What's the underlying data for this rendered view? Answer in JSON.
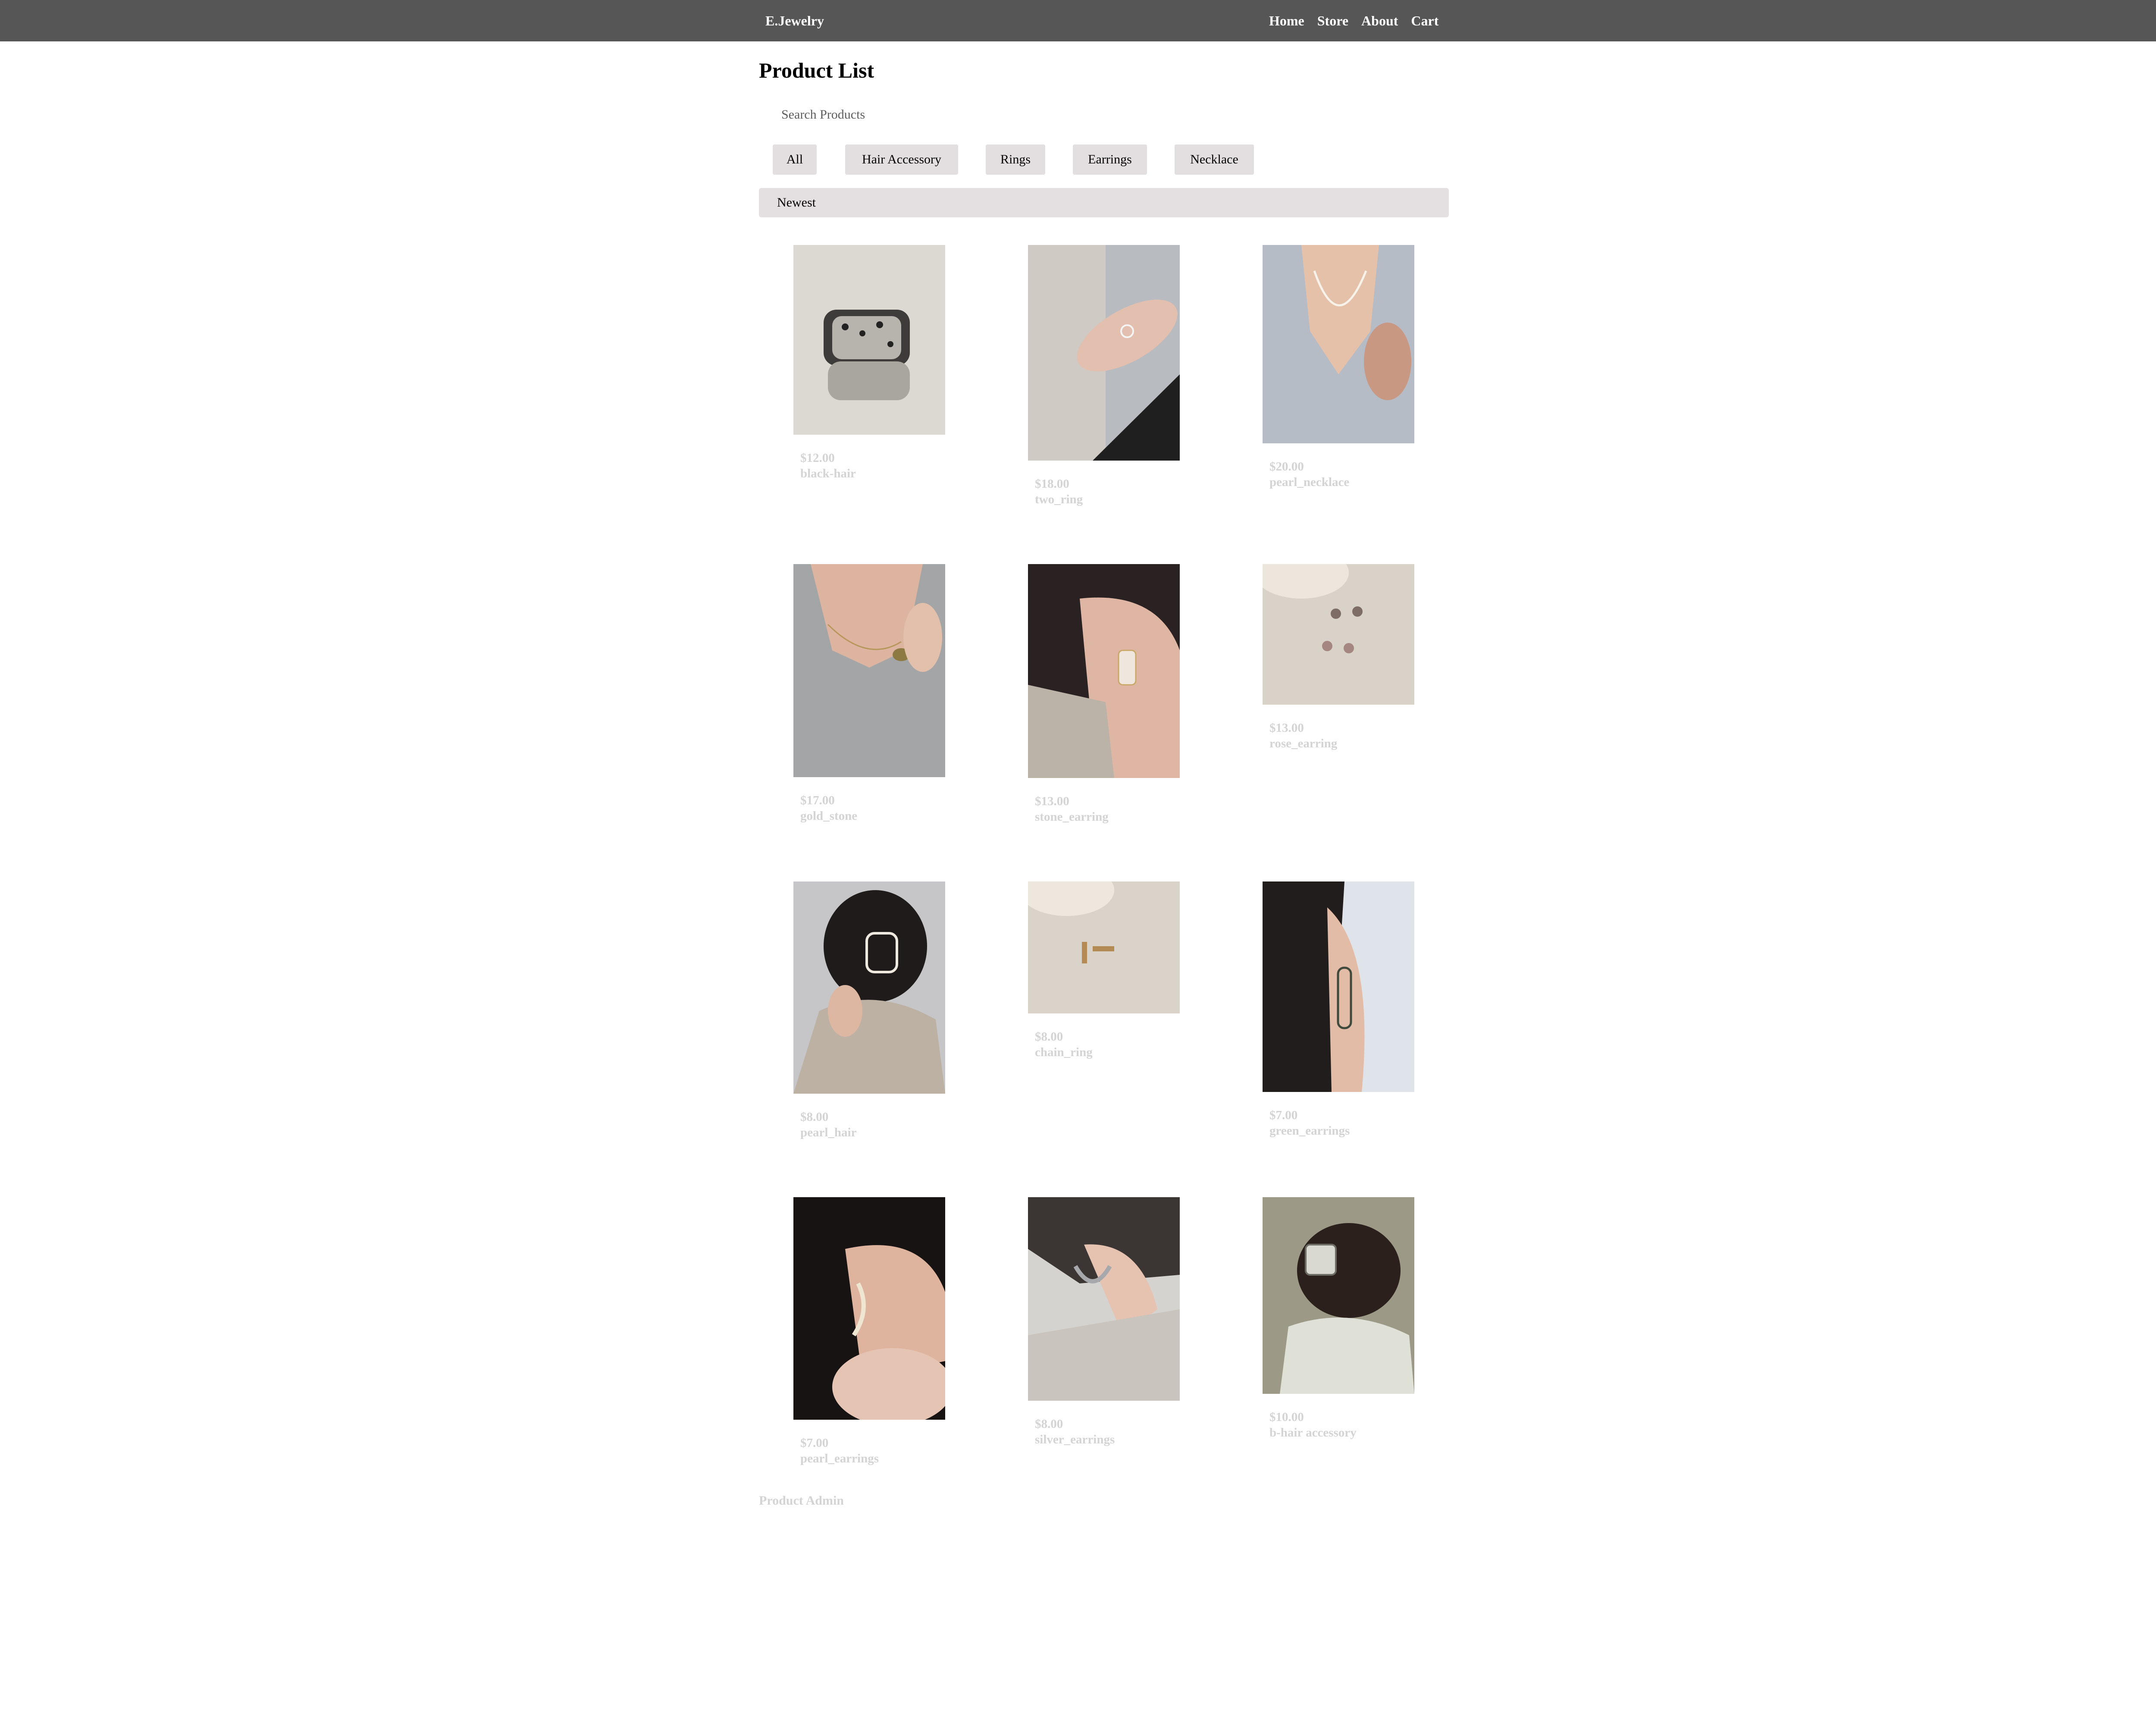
{
  "nav": {
    "brand": "E.Jewelry",
    "links": [
      "Home",
      "Store",
      "About",
      "Cart"
    ]
  },
  "page": {
    "title": "Product List",
    "search_placeholder": "Search Products",
    "sort_label": "Newest",
    "admin_link": "Product Admin"
  },
  "filters": [
    "All",
    "Hair Accessory",
    "Rings",
    "Earrings",
    "Necklace"
  ],
  "products": [
    {
      "price": "$12.00",
      "name": "black-hair"
    },
    {
      "price": "$18.00",
      "name": "two_ring"
    },
    {
      "price": "$20.00",
      "name": "pearl_necklace"
    },
    {
      "price": "$17.00",
      "name": "gold_stone"
    },
    {
      "price": "$13.00",
      "name": "stone_earring"
    },
    {
      "price": "$13.00",
      "name": "rose_earring"
    },
    {
      "price": "$8.00",
      "name": "pearl_hair"
    },
    {
      "price": "$8.00",
      "name": "chain_ring"
    },
    {
      "price": "$7.00",
      "name": "green_earrings"
    },
    {
      "price": "$7.00",
      "name": "pearl_earrings"
    },
    {
      "price": "$8.00",
      "name": "silver_earrings"
    },
    {
      "price": "$10.00",
      "name": "b-hair accessory"
    }
  ],
  "colors": {
    "navbar": "#565656",
    "filter_background": "#e3dedf",
    "muted_text": "#d4d4d4"
  }
}
